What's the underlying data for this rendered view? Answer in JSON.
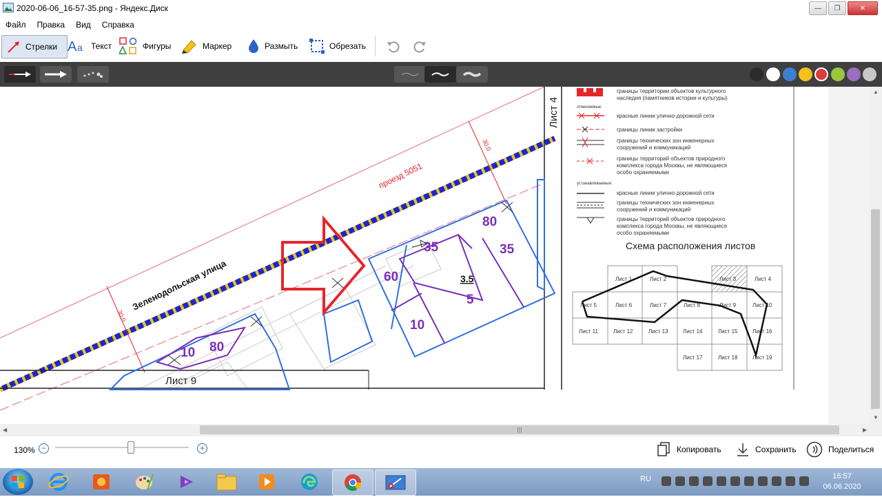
{
  "window": {
    "title": "2020-06-06_16-57-35.png - Яндекс.Диск"
  },
  "menu": [
    "Файл",
    "Правка",
    "Вид",
    "Справка"
  ],
  "toolbar": {
    "arrows": "Стрелки",
    "text": "Текст",
    "shapes": "Фигуры",
    "marker": "Маркер",
    "blur": "Размыть",
    "crop": "Обрезать"
  },
  "colors": {
    "palette": [
      "#2b2b2b",
      "#ffffff",
      "#3d7fd1",
      "#f2c21b",
      "#e03a3a",
      "#9cc63d",
      "#9a6fc1",
      "#c7c7c7"
    ],
    "selected": "#e03a3a",
    "arrow": "#e4262b",
    "zone": "#2f6fe0",
    "label": "#7a2fb8"
  },
  "drawing": {
    "street_name": "Зеленодольская улица",
    "proezd": "проезд 5051",
    "sheet4": "Лист 4",
    "sheet9": "Лист 9",
    "dim": "30,0",
    "dim2": "30,0",
    "lots": {
      "a80": "80",
      "a35": "35",
      "b35": "35",
      "a60": "60",
      "a10": "10",
      "floor": "3.5",
      "height": "5",
      "c10": "10",
      "c80": "80"
    },
    "legend": [
      "границы территории объектов культурного",
      "наследия (памятников истории и культуры)",
      "отменяемые:",
      "красные линии улично-дорожной сети",
      "границы линии застройки",
      "границы технических зон инженерных",
      "сооружений и коммуникаций",
      "границы территорий объектов природного",
      "комплекса города Москвы, не являющиеся",
      "особо охраняемыми",
      "устанавливаемые:",
      "красные линии улично-дорожной сети",
      "границы технических зон инженерных",
      "сооружений и коммуникаций",
      "границы территорий объектов природного",
      "комплекса города Москвы, не являющиеся",
      "особо охраняемыми"
    ],
    "scheme_title": "Схема расположения листов",
    "sheets": {
      "l1": "Лист 1",
      "l2": "Лист 2",
      "l3": "Лист 3",
      "l4": "Лист 4",
      "l5": "Лист 5",
      "l6": "Лист 6",
      "l7": "Лист 7",
      "l8": "Лист 8",
      "l9": "Лист 9",
      "l10": "Лист 10",
      "l11": "Лист 11",
      "l12": "Лист 12",
      "l13": "Лист 13",
      "l14": "Лист 14",
      "l15": "Лист 15",
      "l16": "Лист 16",
      "l17": "Лист 17",
      "l18": "Лист 18",
      "l19": "Лист 19"
    }
  },
  "zoom": {
    "label": "130%",
    "level": 130
  },
  "actions": {
    "copy": "Копировать",
    "save": "Сохранить",
    "share": "Поделиться"
  },
  "taskbar": {
    "lang": "RU",
    "time": "16:57",
    "date": "06.06.2020"
  }
}
